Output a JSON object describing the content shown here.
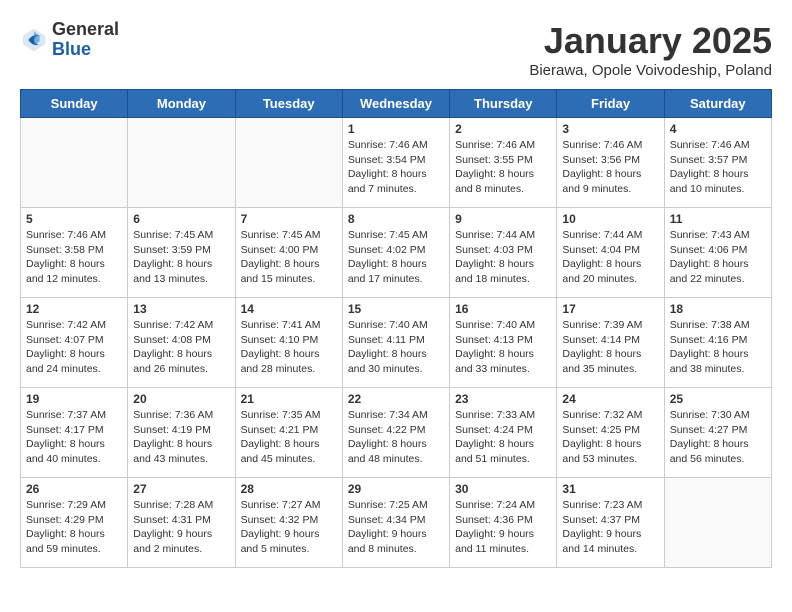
{
  "logo": {
    "general": "General",
    "blue": "Blue"
  },
  "header": {
    "month": "January 2025",
    "location": "Bierawa, Opole Voivodeship, Poland"
  },
  "weekdays": [
    "Sunday",
    "Monday",
    "Tuesday",
    "Wednesday",
    "Thursday",
    "Friday",
    "Saturday"
  ],
  "weeks": [
    [
      {
        "day": "",
        "info": ""
      },
      {
        "day": "",
        "info": ""
      },
      {
        "day": "",
        "info": ""
      },
      {
        "day": "1",
        "info": "Sunrise: 7:46 AM\nSunset: 3:54 PM\nDaylight: 8 hours\nand 7 minutes."
      },
      {
        "day": "2",
        "info": "Sunrise: 7:46 AM\nSunset: 3:55 PM\nDaylight: 8 hours\nand 8 minutes."
      },
      {
        "day": "3",
        "info": "Sunrise: 7:46 AM\nSunset: 3:56 PM\nDaylight: 8 hours\nand 9 minutes."
      },
      {
        "day": "4",
        "info": "Sunrise: 7:46 AM\nSunset: 3:57 PM\nDaylight: 8 hours\nand 10 minutes."
      }
    ],
    [
      {
        "day": "5",
        "info": "Sunrise: 7:46 AM\nSunset: 3:58 PM\nDaylight: 8 hours\nand 12 minutes."
      },
      {
        "day": "6",
        "info": "Sunrise: 7:45 AM\nSunset: 3:59 PM\nDaylight: 8 hours\nand 13 minutes."
      },
      {
        "day": "7",
        "info": "Sunrise: 7:45 AM\nSunset: 4:00 PM\nDaylight: 8 hours\nand 15 minutes."
      },
      {
        "day": "8",
        "info": "Sunrise: 7:45 AM\nSunset: 4:02 PM\nDaylight: 8 hours\nand 17 minutes."
      },
      {
        "day": "9",
        "info": "Sunrise: 7:44 AM\nSunset: 4:03 PM\nDaylight: 8 hours\nand 18 minutes."
      },
      {
        "day": "10",
        "info": "Sunrise: 7:44 AM\nSunset: 4:04 PM\nDaylight: 8 hours\nand 20 minutes."
      },
      {
        "day": "11",
        "info": "Sunrise: 7:43 AM\nSunset: 4:06 PM\nDaylight: 8 hours\nand 22 minutes."
      }
    ],
    [
      {
        "day": "12",
        "info": "Sunrise: 7:42 AM\nSunset: 4:07 PM\nDaylight: 8 hours\nand 24 minutes."
      },
      {
        "day": "13",
        "info": "Sunrise: 7:42 AM\nSunset: 4:08 PM\nDaylight: 8 hours\nand 26 minutes."
      },
      {
        "day": "14",
        "info": "Sunrise: 7:41 AM\nSunset: 4:10 PM\nDaylight: 8 hours\nand 28 minutes."
      },
      {
        "day": "15",
        "info": "Sunrise: 7:40 AM\nSunset: 4:11 PM\nDaylight: 8 hours\nand 30 minutes."
      },
      {
        "day": "16",
        "info": "Sunrise: 7:40 AM\nSunset: 4:13 PM\nDaylight: 8 hours\nand 33 minutes."
      },
      {
        "day": "17",
        "info": "Sunrise: 7:39 AM\nSunset: 4:14 PM\nDaylight: 8 hours\nand 35 minutes."
      },
      {
        "day": "18",
        "info": "Sunrise: 7:38 AM\nSunset: 4:16 PM\nDaylight: 8 hours\nand 38 minutes."
      }
    ],
    [
      {
        "day": "19",
        "info": "Sunrise: 7:37 AM\nSunset: 4:17 PM\nDaylight: 8 hours\nand 40 minutes."
      },
      {
        "day": "20",
        "info": "Sunrise: 7:36 AM\nSunset: 4:19 PM\nDaylight: 8 hours\nand 43 minutes."
      },
      {
        "day": "21",
        "info": "Sunrise: 7:35 AM\nSunset: 4:21 PM\nDaylight: 8 hours\nand 45 minutes."
      },
      {
        "day": "22",
        "info": "Sunrise: 7:34 AM\nSunset: 4:22 PM\nDaylight: 8 hours\nand 48 minutes."
      },
      {
        "day": "23",
        "info": "Sunrise: 7:33 AM\nSunset: 4:24 PM\nDaylight: 8 hours\nand 51 minutes."
      },
      {
        "day": "24",
        "info": "Sunrise: 7:32 AM\nSunset: 4:25 PM\nDaylight: 8 hours\nand 53 minutes."
      },
      {
        "day": "25",
        "info": "Sunrise: 7:30 AM\nSunset: 4:27 PM\nDaylight: 8 hours\nand 56 minutes."
      }
    ],
    [
      {
        "day": "26",
        "info": "Sunrise: 7:29 AM\nSunset: 4:29 PM\nDaylight: 8 hours\nand 59 minutes."
      },
      {
        "day": "27",
        "info": "Sunrise: 7:28 AM\nSunset: 4:31 PM\nDaylight: 9 hours\nand 2 minutes."
      },
      {
        "day": "28",
        "info": "Sunrise: 7:27 AM\nSunset: 4:32 PM\nDaylight: 9 hours\nand 5 minutes."
      },
      {
        "day": "29",
        "info": "Sunrise: 7:25 AM\nSunset: 4:34 PM\nDaylight: 9 hours\nand 8 minutes."
      },
      {
        "day": "30",
        "info": "Sunrise: 7:24 AM\nSunset: 4:36 PM\nDaylight: 9 hours\nand 11 minutes."
      },
      {
        "day": "31",
        "info": "Sunrise: 7:23 AM\nSunset: 4:37 PM\nDaylight: 9 hours\nand 14 minutes."
      },
      {
        "day": "",
        "info": ""
      }
    ]
  ]
}
